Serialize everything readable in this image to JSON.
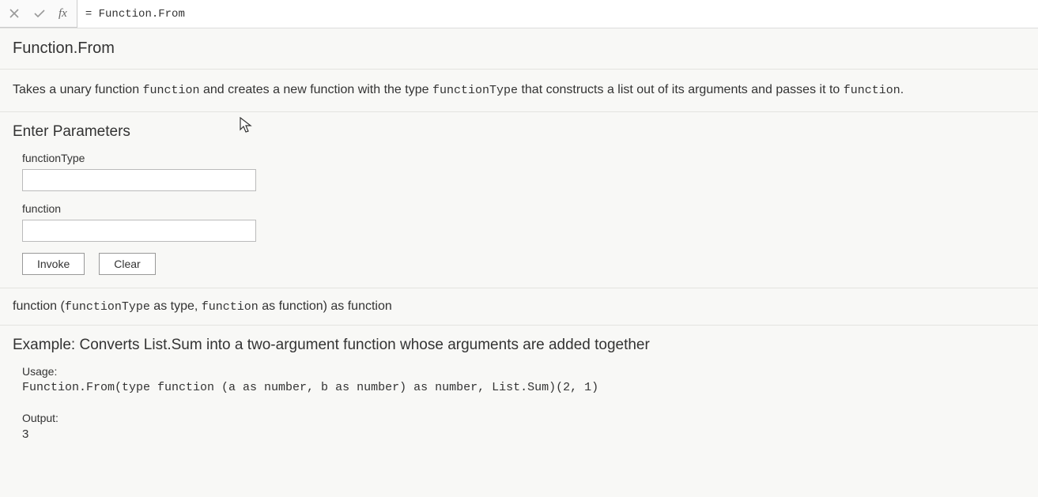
{
  "formula_bar": {
    "fx_label": "fx",
    "value": "= Function.From"
  },
  "header": {
    "title": "Function.From"
  },
  "description": {
    "pre": "Takes a unary function ",
    "code1": "function",
    "mid1": " and creates a new function with the type ",
    "code2": "functionType",
    "mid2": " that constructs a list out of its arguments and passes it to ",
    "code3": "function",
    "post": "."
  },
  "params": {
    "heading": "Enter Parameters",
    "p1_label": "functionType",
    "p1_value": "",
    "p2_label": "function",
    "p2_value": "",
    "invoke": "Invoke",
    "clear": "Clear"
  },
  "signature": {
    "pre": "function (",
    "arg1": "functionType",
    "t1": " as type, ",
    "arg2": "function",
    "t2": " as function) as function"
  },
  "example": {
    "title": "Example: Converts List.Sum into a two-argument function whose arguments are added together",
    "usage_label": "Usage:",
    "usage_code": "Function.From(type function (a as number, b as number) as number, List.Sum)(2, 1)",
    "output_label": "Output:",
    "output_value": "3"
  }
}
